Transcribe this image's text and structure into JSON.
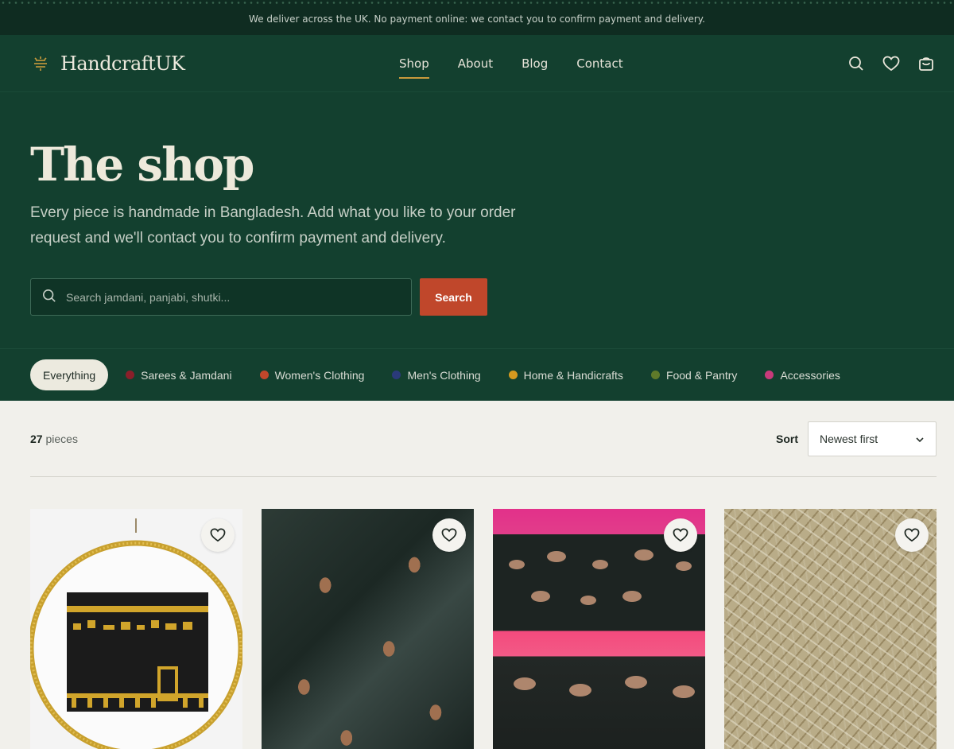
{
  "announcement": "We deliver across the UK. No payment online: we contact you to confirm payment and delivery.",
  "brand": {
    "name": "HandcraftUK",
    "logo_icon": "sun-mark-icon",
    "accent": "#c99a3c"
  },
  "nav": {
    "links": [
      {
        "label": "Shop",
        "active": true
      },
      {
        "label": "About",
        "active": false
      },
      {
        "label": "Blog",
        "active": false
      },
      {
        "label": "Contact",
        "active": false
      }
    ],
    "icons": [
      "search-icon",
      "heart-icon",
      "bag-icon"
    ]
  },
  "hero": {
    "title": "The shop",
    "subtitle": "Every piece is handmade in Bangladesh. Add what you like to your order request and we'll contact you to confirm payment and delivery.",
    "search": {
      "placeholder": "Search jamdani, panjabi, shutki...",
      "button": "Search"
    }
  },
  "categories": [
    {
      "label": "Everything",
      "active": true,
      "color": ""
    },
    {
      "label": "Sarees & Jamdani",
      "active": false,
      "color": "#8a1f2a"
    },
    {
      "label": "Women's Clothing",
      "active": false,
      "color": "#c0472b"
    },
    {
      "label": "Men's Clothing",
      "active": false,
      "color": "#2a3a7a"
    },
    {
      "label": "Home & Handicrafts",
      "active": false,
      "color": "#d59a1f"
    },
    {
      "label": "Food & Pantry",
      "active": false,
      "color": "#5f7a2a"
    },
    {
      "label": "Accessories",
      "active": false,
      "color": "#c83a7a"
    }
  ],
  "results": {
    "count": "27",
    "count_suffix": "pieces",
    "sort_label": "Sort",
    "sort_value": "Newest first"
  },
  "products": [
    {
      "image": "kaaba-beadwork-hoop"
    },
    {
      "image": "dark-jamdani-saree"
    },
    {
      "image": "black-pink-saree-stack"
    },
    {
      "image": "dried-fish-shutki"
    }
  ],
  "colors": {
    "primary_dark": "#13402f",
    "announce_bg": "#0f2c21",
    "cta": "#c0472b",
    "page_bg": "#f1f0eb"
  }
}
